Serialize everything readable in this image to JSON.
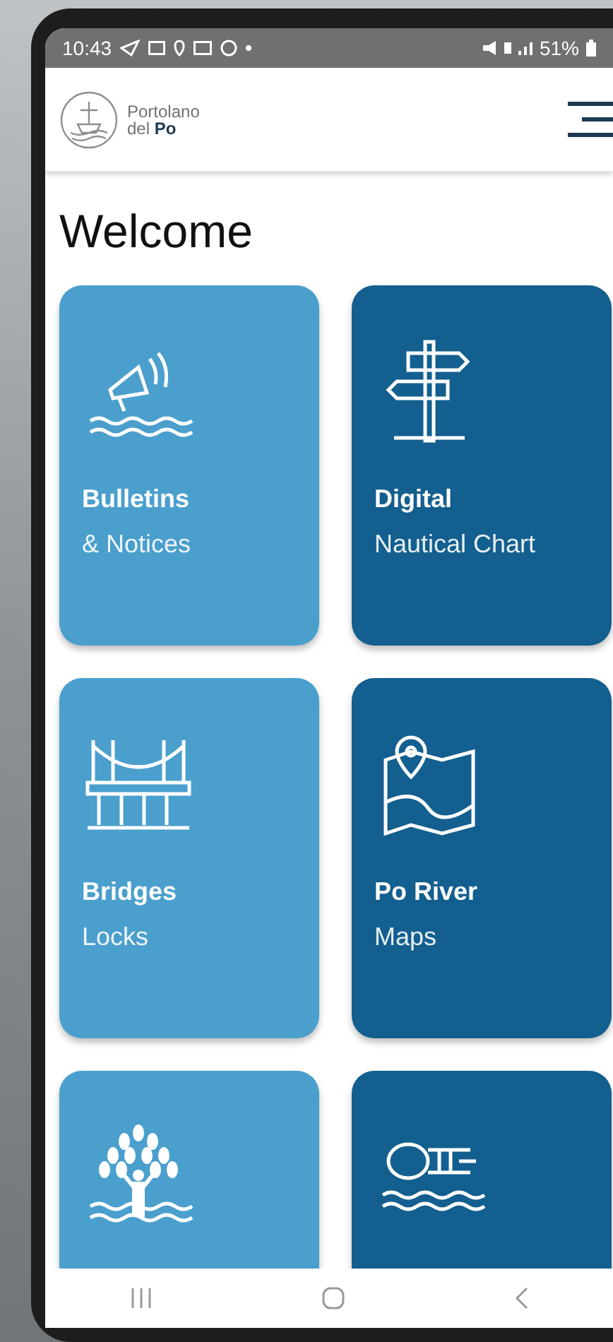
{
  "status_bar": {
    "time": "10:43",
    "battery": "51%"
  },
  "header": {
    "logo_line_1": "Portolano",
    "logo_line_2": "del **Po**"
  },
  "title": "Welcome",
  "cards": [
    {
      "title": "Bulletins",
      "subtitle": "& Notices",
      "color": "#4a9fcd"
    },
    {
      "title": "Digital",
      "subtitle": "Nautical Chart",
      "color": "#135f8f"
    },
    {
      "title": "Bridges",
      "subtitle": "Locks",
      "color": "#4a9fcd"
    },
    {
      "title": "Po River",
      "subtitle": "Maps",
      "color": "#135f8f"
    },
    {
      "color": "#4a9fcd"
    },
    {
      "color": "#135f8f"
    }
  ]
}
